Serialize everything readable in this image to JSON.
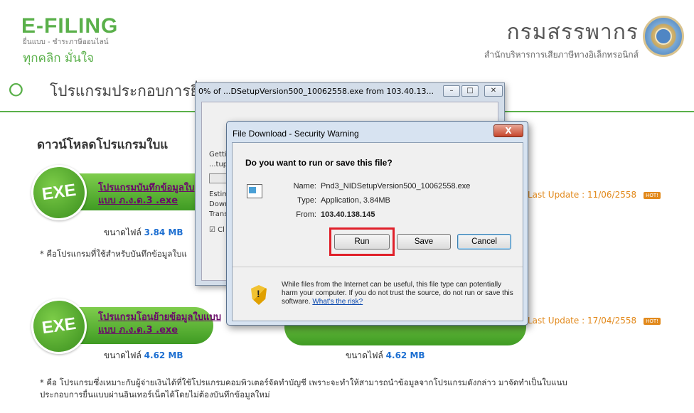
{
  "site": {
    "logo_title": "E-FILING",
    "logo_subtitle": "ยื่นแบบ - ชำระภาษีออนไลน์",
    "logo_tagline": "ทุกคลิก มั่นใจ",
    "department_title": "กรมสรรพากร",
    "department_subtitle": "สำนักบริหารการเสียภาษีทางอิเล็กทรอนิกส์",
    "accent_color": "#5ab04a"
  },
  "page": {
    "title": "โปรแกรมประกอบการยื่น",
    "section_title": "ดาวน์โหลดโปรแกรมใบแ"
  },
  "downloads": [
    {
      "badge": "EXE",
      "link_line1": "โปรแกรมบันทึกข้อมูลใบ",
      "link_line2": "แบบ ภ.ง.ด.3 .exe",
      "size_label": "ขนาดไฟล์",
      "size_value": "3.84 MB",
      "last_update": "Last Update : 11/06/2558",
      "hot": "HOT!"
    },
    {
      "badge": "EXE",
      "link_line1": "โปรแกรมโอนย้ายข้อมูลใบแบบ",
      "link_line2": "แบบ ภ.ง.ด.3 .exe",
      "size_label": "ขนาดไฟล์",
      "size_value": "4.62 MB",
      "last_update": "Last Update : 17/04/2558",
      "hot": "HOT!"
    }
  ],
  "right_size": {
    "label": "ขนาดไฟล์",
    "value": "4.62 MB"
  },
  "notes": {
    "note1": "* คือโปรแกรมที่ใช้สำหรับบันทึกข้อมูลใบแ",
    "note2_line1": "* คือ โปรแกรมซึ่งเหมาะกับผู้จ่ายเงินได้ที่ใช้โปรแกรมคอมพิวเตอร์จัดทำบัญชี เพราะจะทำให้สามารถนำข้อมูลจากโปรแกรมดังกล่าว มาจัดทำเป็นใบแนบ",
    "note2_line2": "ประกอบการยื่นแบบผ่านอินเทอร์เน็ตได้โดยไม่ต้องบันทึกข้อมูลใหม่"
  },
  "progress_window": {
    "title": "0% of ...DSetupVersion500_10062558.exe from 103.40.13...",
    "progress": 0,
    "lines": [
      "Gettin",
      "...tup",
      "Estim",
      "Down",
      "Trans",
      "Cl"
    ]
  },
  "dialog": {
    "title": "File Download - Security Warning",
    "close": "X",
    "question": "Do you want to run or save this file?",
    "name_label": "Name:",
    "name_value": "Pnd3_NIDSetupVersion500_10062558.exe",
    "type_label": "Type:",
    "type_value": "Application, 3.84MB",
    "from_label": "From:",
    "from_value": "103.40.138.145",
    "run": "Run",
    "save": "Save",
    "cancel": "Cancel",
    "warning_text": "While files from the Internet can be useful, this file type can potentially harm your computer. If you do not trust the source, do not run or save this software.",
    "risk_link": "What's the risk?"
  }
}
